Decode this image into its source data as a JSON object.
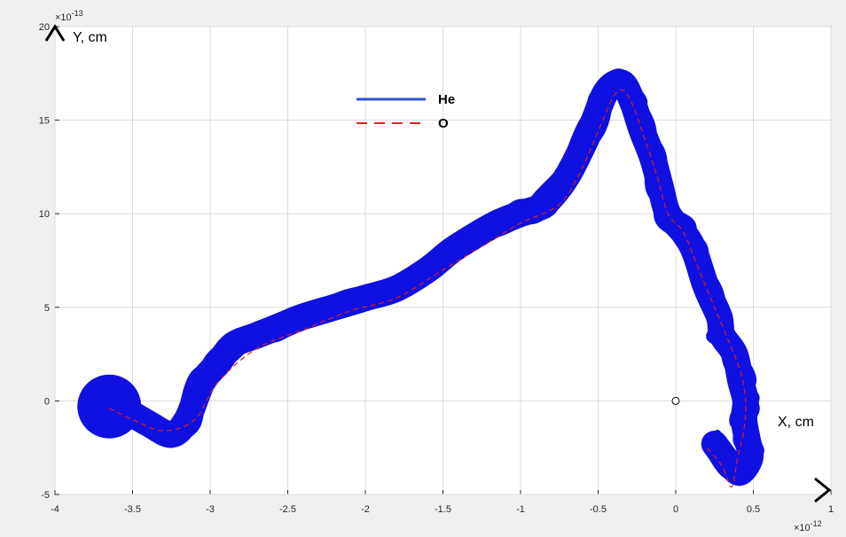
{
  "chart_data": {
    "type": "line",
    "xlim": [
      -4,
      1
    ],
    "ylim": [
      -5,
      20
    ],
    "x_exponent_label": "×10",
    "x_exponent_power": "-12",
    "y_exponent_label": "×10",
    "y_exponent_power": "-13",
    "xlabel": "X, cm",
    "ylabel": "Y, cm",
    "xticks": [
      {
        "value": -4,
        "label": "-4"
      },
      {
        "value": -3.5,
        "label": "-3.5"
      },
      {
        "value": -3,
        "label": "-3"
      },
      {
        "value": -2.5,
        "label": "-2.5"
      },
      {
        "value": -2,
        "label": "-2"
      },
      {
        "value": -1.5,
        "label": "-1.5"
      },
      {
        "value": -1,
        "label": "-1"
      },
      {
        "value": -0.5,
        "label": "-0.5"
      },
      {
        "value": 0,
        "label": "0"
      },
      {
        "value": 0.5,
        "label": "0.5"
      },
      {
        "value": 1,
        "label": "1"
      }
    ],
    "yticks": [
      {
        "value": -5,
        "label": "-5"
      },
      {
        "value": 0,
        "label": "0"
      },
      {
        "value": 5,
        "label": "5"
      },
      {
        "value": 10,
        "label": "10"
      },
      {
        "value": 15,
        "label": "15"
      },
      {
        "value": 20,
        "label": "20"
      }
    ],
    "grid": true,
    "legend_position": "upper-center",
    "series": [
      {
        "name": "He",
        "color": "#1010e0",
        "style": "solid-thick",
        "x": [
          -3.65,
          -3.55,
          -3.4,
          -3.25,
          -3.15,
          -3.05,
          -2.95,
          -2.85,
          -2.7,
          -2.55,
          -2.4,
          -2.2,
          -2.0,
          -1.8,
          -1.6,
          -1.45,
          -1.3,
          -1.15,
          -1.0,
          -0.85,
          -0.7,
          -0.55,
          -0.45,
          -0.35,
          -0.28,
          -0.22,
          -0.15,
          -0.1,
          -0.05,
          0.05,
          0.12,
          0.2,
          0.28,
          0.3,
          0.38,
          0.42,
          0.45,
          0.44,
          0.46,
          0.48,
          0.42,
          0.36,
          0.25
        ],
        "y": [
          -0.3,
          -0.5,
          -1.2,
          -1.8,
          -1.0,
          1.0,
          2.0,
          3.0,
          3.5,
          4.0,
          4.5,
          5.0,
          5.5,
          6.0,
          7.0,
          8.0,
          8.8,
          9.5,
          10.0,
          10.5,
          12.0,
          14.5,
          16.5,
          17.0,
          16.0,
          14.5,
          13.0,
          11.5,
          10.0,
          9.0,
          8.0,
          6.0,
          4.5,
          3.5,
          2.5,
          1.0,
          0.0,
          -1.0,
          -2.0,
          -3.0,
          -3.8,
          -3.5,
          -2.3
        ]
      },
      {
        "name": "O",
        "color": "#e02020",
        "style": "dashed",
        "x": [
          -3.65,
          -3.5,
          -3.3,
          -3.1,
          -2.95,
          -2.7,
          -2.4,
          -2.1,
          -1.8,
          -1.5,
          -1.2,
          -1.0,
          -0.75,
          -0.6,
          -0.48,
          -0.38,
          -0.3,
          -0.2,
          -0.12,
          -0.05,
          0.05,
          0.15,
          0.25,
          0.35,
          0.42,
          0.45,
          0.44,
          0.4,
          0.36,
          0.3,
          0.2
        ],
        "y": [
          -0.4,
          -1.0,
          -1.6,
          -1.0,
          1.0,
          2.8,
          3.8,
          4.8,
          5.5,
          7.0,
          8.5,
          9.5,
          10.5,
          12.5,
          14.8,
          16.5,
          16.2,
          14.0,
          12.0,
          10.0,
          9.0,
          7.0,
          5.0,
          3.0,
          1.5,
          0.0,
          -1.5,
          -3.0,
          -4.6,
          -3.5,
          -2.5
        ]
      }
    ],
    "annotations": [
      {
        "type": "circle-marker",
        "x": 0,
        "y": 0
      }
    ]
  }
}
